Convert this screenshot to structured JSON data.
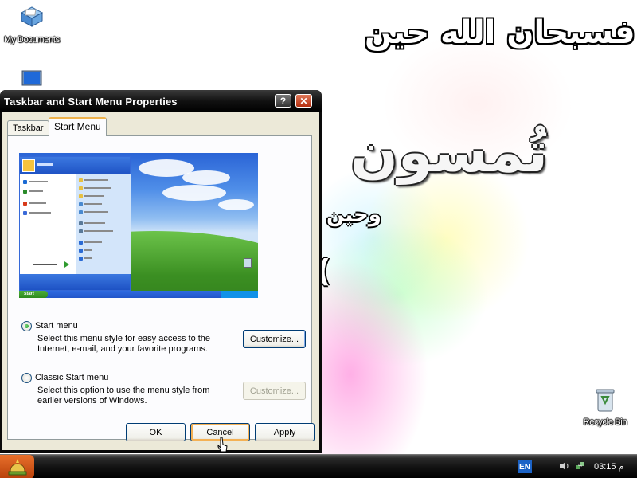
{
  "desktop": {
    "icons": [
      {
        "label": "My Documents"
      },
      {
        "label": "Recycle Bin"
      }
    ],
    "wallpaper_text": {
      "line1": "فسبحان الله حين",
      "line2": "تُمسون",
      "line3": "وحين",
      "line4": ")"
    }
  },
  "dialog": {
    "title": "Taskbar and Start Menu Properties",
    "help_glyph": "?",
    "close_glyph": "✕",
    "tabs": [
      {
        "label": "Taskbar"
      },
      {
        "label": "Start Menu",
        "selected": true
      }
    ],
    "preview": {
      "start_label": "start"
    },
    "options": [
      {
        "label": "Start menu",
        "checked": true,
        "description": "Select this menu style for easy access to the Internet, e-mail, and your favorite programs.",
        "button": "Customize...",
        "button_enabled": true
      },
      {
        "label": "Classic Start menu",
        "checked": false,
        "description": "Select this option to use the menu style from earlier versions of Windows.",
        "button": "Customize...",
        "button_enabled": false
      }
    ],
    "buttons": {
      "ok": "OK",
      "cancel": "Cancel",
      "apply": "Apply"
    }
  },
  "taskbar": {
    "language": "EN",
    "clock": "03:15 م"
  },
  "colors": {
    "taskbar": "#111111",
    "dialog_frame": "#0a0a0a",
    "dialog_face": "#ece9d8",
    "close_button": "#c8431e",
    "focus_outline": "#f4b155"
  }
}
